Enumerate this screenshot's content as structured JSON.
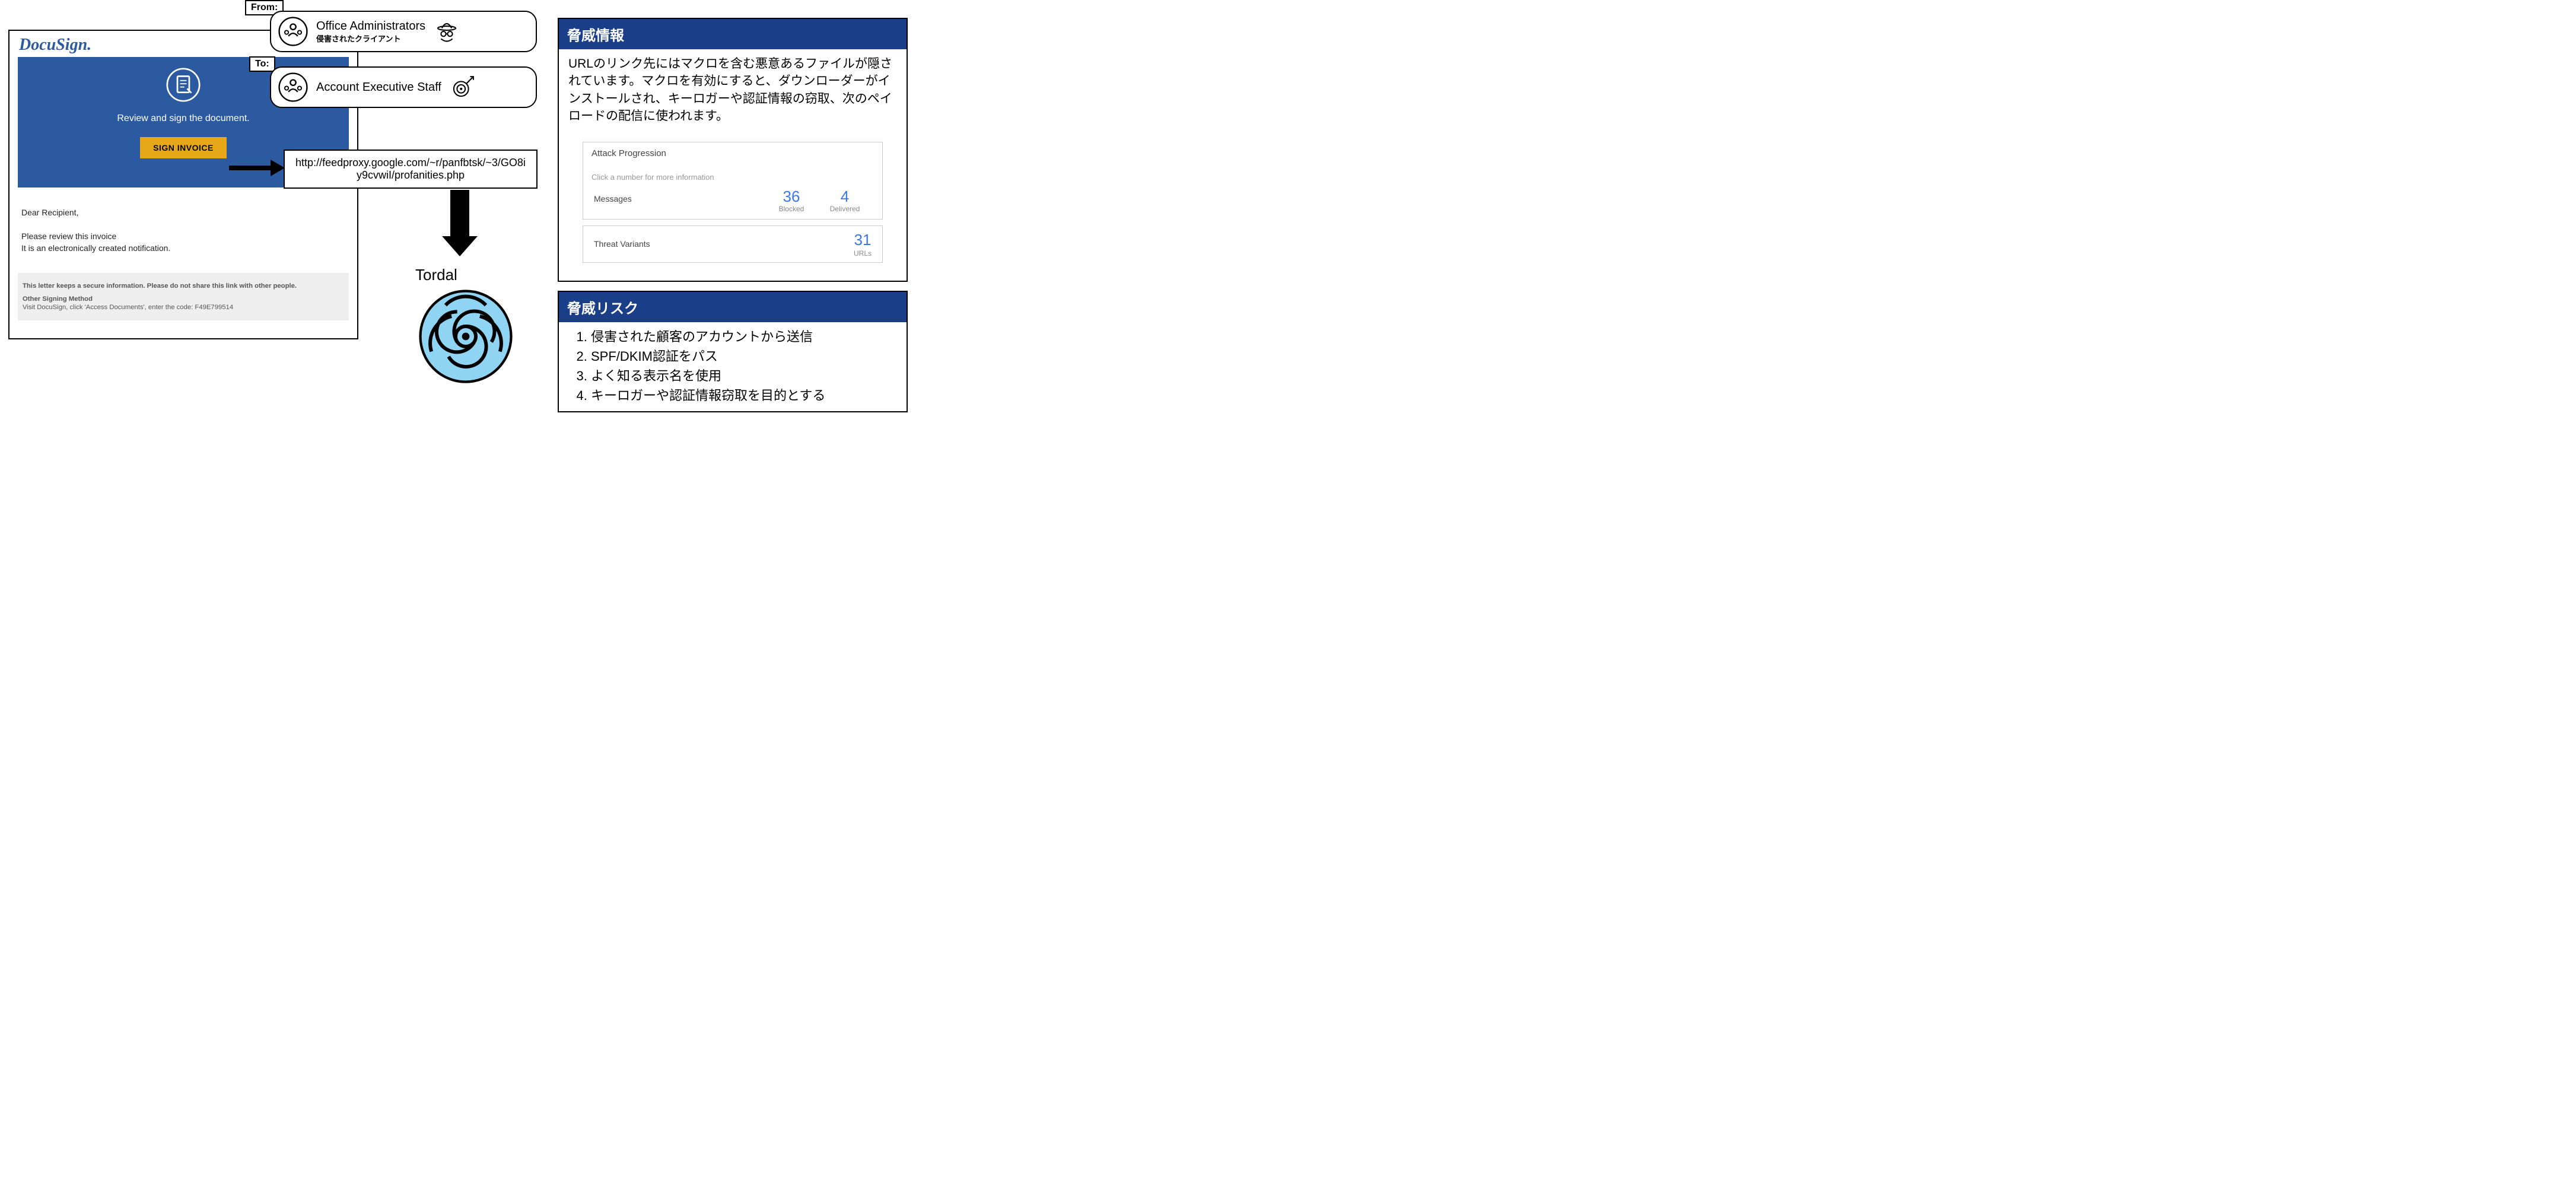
{
  "docusign": {
    "logo_text": "DocuSign",
    "hero_text": "Review and sign the document.",
    "button_label": "SIGN INVOICE",
    "greeting": "Dear Recipient,",
    "line1": "Please review this invoice",
    "line2": "It is an electronically created notification.",
    "footer_warn": "This letter keeps a secure information. Please do not share this link with other people.",
    "footer_method_title": "Other Signing Method",
    "footer_method_text": "Visit DocuSign, click 'Access Documents', enter the code: F49E799514"
  },
  "from": {
    "tag": "From:",
    "title": "Office Administrators",
    "subtitle": "侵害されたクライアント"
  },
  "to": {
    "tag": "To:",
    "title": "Account Executive Staff"
  },
  "url": {
    "text": "http://feedproxy.google.com/~r/panfbtsk/~3/GO8iy9cvwiI/profanities.php"
  },
  "malware": {
    "name": "Tordal"
  },
  "threat_info": {
    "header": "脅威情報",
    "body": "URLのリンク先にはマクロを含む悪意あるファイルが隠されています。マクロを有効にすると、ダウンローダーがインストールされ、キーロガーや認証情報の窃取、次のペイロードの配信に使われます。",
    "attack_progression": {
      "title": "Attack Progression",
      "subtitle": "Click a number for more information",
      "messages_label": "Messages",
      "blocked_count": "36",
      "blocked_label": "Blocked",
      "delivered_count": "4",
      "delivered_label": "Delivered",
      "variants_label": "Threat Variants",
      "variants_count": "31",
      "variants_unit": "URLs"
    }
  },
  "threat_risk": {
    "header": "脅威リスク",
    "items": [
      "侵害された顧客のアカウントから送信",
      "SPF/DKIM認証をパス",
      "よく知る表示名を使用",
      "キーロガーや認証情報窃取を目的とする"
    ]
  }
}
